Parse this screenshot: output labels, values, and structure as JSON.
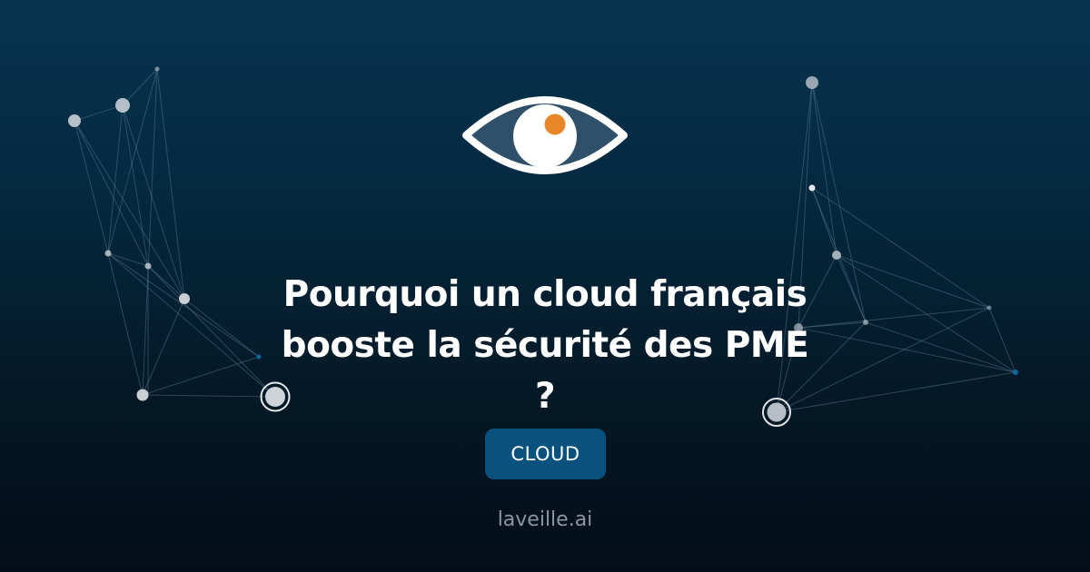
{
  "article": {
    "title": "Pourquoi un cloud français\nbooste la sécurité des PME\n?",
    "category": "CLOUD",
    "site": "laveille.ai"
  },
  "icons": {
    "logo": "eye-icon"
  },
  "colors": {
    "background_top": "#06344f",
    "background_bottom": "#030d17",
    "category_badge": "#0a527e",
    "eye_pupil_dot": "#e8872a",
    "text_primary": "#ffffff",
    "text_muted": "#8a97a3"
  }
}
